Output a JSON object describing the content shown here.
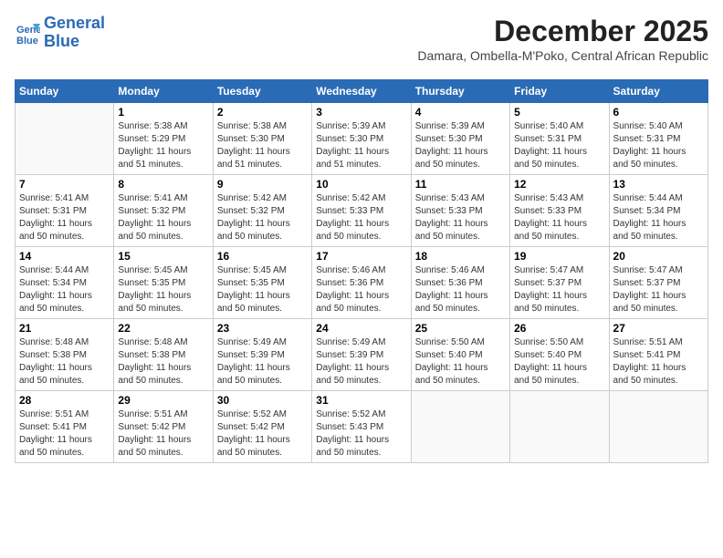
{
  "logo": {
    "line1": "General",
    "line2": "Blue"
  },
  "title": "December 2025",
  "location": "Damara, Ombella-M'Poko, Central African Republic",
  "days_of_week": [
    "Sunday",
    "Monday",
    "Tuesday",
    "Wednesday",
    "Thursday",
    "Friday",
    "Saturday"
  ],
  "weeks": [
    [
      {
        "day": "",
        "info": ""
      },
      {
        "day": "1",
        "info": "Sunrise: 5:38 AM\nSunset: 5:29 PM\nDaylight: 11 hours\nand 51 minutes."
      },
      {
        "day": "2",
        "info": "Sunrise: 5:38 AM\nSunset: 5:30 PM\nDaylight: 11 hours\nand 51 minutes."
      },
      {
        "day": "3",
        "info": "Sunrise: 5:39 AM\nSunset: 5:30 PM\nDaylight: 11 hours\nand 51 minutes."
      },
      {
        "day": "4",
        "info": "Sunrise: 5:39 AM\nSunset: 5:30 PM\nDaylight: 11 hours\nand 50 minutes."
      },
      {
        "day": "5",
        "info": "Sunrise: 5:40 AM\nSunset: 5:31 PM\nDaylight: 11 hours\nand 50 minutes."
      },
      {
        "day": "6",
        "info": "Sunrise: 5:40 AM\nSunset: 5:31 PM\nDaylight: 11 hours\nand 50 minutes."
      }
    ],
    [
      {
        "day": "7",
        "info": "Sunrise: 5:41 AM\nSunset: 5:31 PM\nDaylight: 11 hours\nand 50 minutes."
      },
      {
        "day": "8",
        "info": "Sunrise: 5:41 AM\nSunset: 5:32 PM\nDaylight: 11 hours\nand 50 minutes."
      },
      {
        "day": "9",
        "info": "Sunrise: 5:42 AM\nSunset: 5:32 PM\nDaylight: 11 hours\nand 50 minutes."
      },
      {
        "day": "10",
        "info": "Sunrise: 5:42 AM\nSunset: 5:33 PM\nDaylight: 11 hours\nand 50 minutes."
      },
      {
        "day": "11",
        "info": "Sunrise: 5:43 AM\nSunset: 5:33 PM\nDaylight: 11 hours\nand 50 minutes."
      },
      {
        "day": "12",
        "info": "Sunrise: 5:43 AM\nSunset: 5:33 PM\nDaylight: 11 hours\nand 50 minutes."
      },
      {
        "day": "13",
        "info": "Sunrise: 5:44 AM\nSunset: 5:34 PM\nDaylight: 11 hours\nand 50 minutes."
      }
    ],
    [
      {
        "day": "14",
        "info": "Sunrise: 5:44 AM\nSunset: 5:34 PM\nDaylight: 11 hours\nand 50 minutes."
      },
      {
        "day": "15",
        "info": "Sunrise: 5:45 AM\nSunset: 5:35 PM\nDaylight: 11 hours\nand 50 minutes."
      },
      {
        "day": "16",
        "info": "Sunrise: 5:45 AM\nSunset: 5:35 PM\nDaylight: 11 hours\nand 50 minutes."
      },
      {
        "day": "17",
        "info": "Sunrise: 5:46 AM\nSunset: 5:36 PM\nDaylight: 11 hours\nand 50 minutes."
      },
      {
        "day": "18",
        "info": "Sunrise: 5:46 AM\nSunset: 5:36 PM\nDaylight: 11 hours\nand 50 minutes."
      },
      {
        "day": "19",
        "info": "Sunrise: 5:47 AM\nSunset: 5:37 PM\nDaylight: 11 hours\nand 50 minutes."
      },
      {
        "day": "20",
        "info": "Sunrise: 5:47 AM\nSunset: 5:37 PM\nDaylight: 11 hours\nand 50 minutes."
      }
    ],
    [
      {
        "day": "21",
        "info": "Sunrise: 5:48 AM\nSunset: 5:38 PM\nDaylight: 11 hours\nand 50 minutes."
      },
      {
        "day": "22",
        "info": "Sunrise: 5:48 AM\nSunset: 5:38 PM\nDaylight: 11 hours\nand 50 minutes."
      },
      {
        "day": "23",
        "info": "Sunrise: 5:49 AM\nSunset: 5:39 PM\nDaylight: 11 hours\nand 50 minutes."
      },
      {
        "day": "24",
        "info": "Sunrise: 5:49 AM\nSunset: 5:39 PM\nDaylight: 11 hours\nand 50 minutes."
      },
      {
        "day": "25",
        "info": "Sunrise: 5:50 AM\nSunset: 5:40 PM\nDaylight: 11 hours\nand 50 minutes."
      },
      {
        "day": "26",
        "info": "Sunrise: 5:50 AM\nSunset: 5:40 PM\nDaylight: 11 hours\nand 50 minutes."
      },
      {
        "day": "27",
        "info": "Sunrise: 5:51 AM\nSunset: 5:41 PM\nDaylight: 11 hours\nand 50 minutes."
      }
    ],
    [
      {
        "day": "28",
        "info": "Sunrise: 5:51 AM\nSunset: 5:41 PM\nDaylight: 11 hours\nand 50 minutes."
      },
      {
        "day": "29",
        "info": "Sunrise: 5:51 AM\nSunset: 5:42 PM\nDaylight: 11 hours\nand 50 minutes."
      },
      {
        "day": "30",
        "info": "Sunrise: 5:52 AM\nSunset: 5:42 PM\nDaylight: 11 hours\nand 50 minutes."
      },
      {
        "day": "31",
        "info": "Sunrise: 5:52 AM\nSunset: 5:43 PM\nDaylight: 11 hours\nand 50 minutes."
      },
      {
        "day": "",
        "info": ""
      },
      {
        "day": "",
        "info": ""
      },
      {
        "day": "",
        "info": ""
      }
    ]
  ]
}
